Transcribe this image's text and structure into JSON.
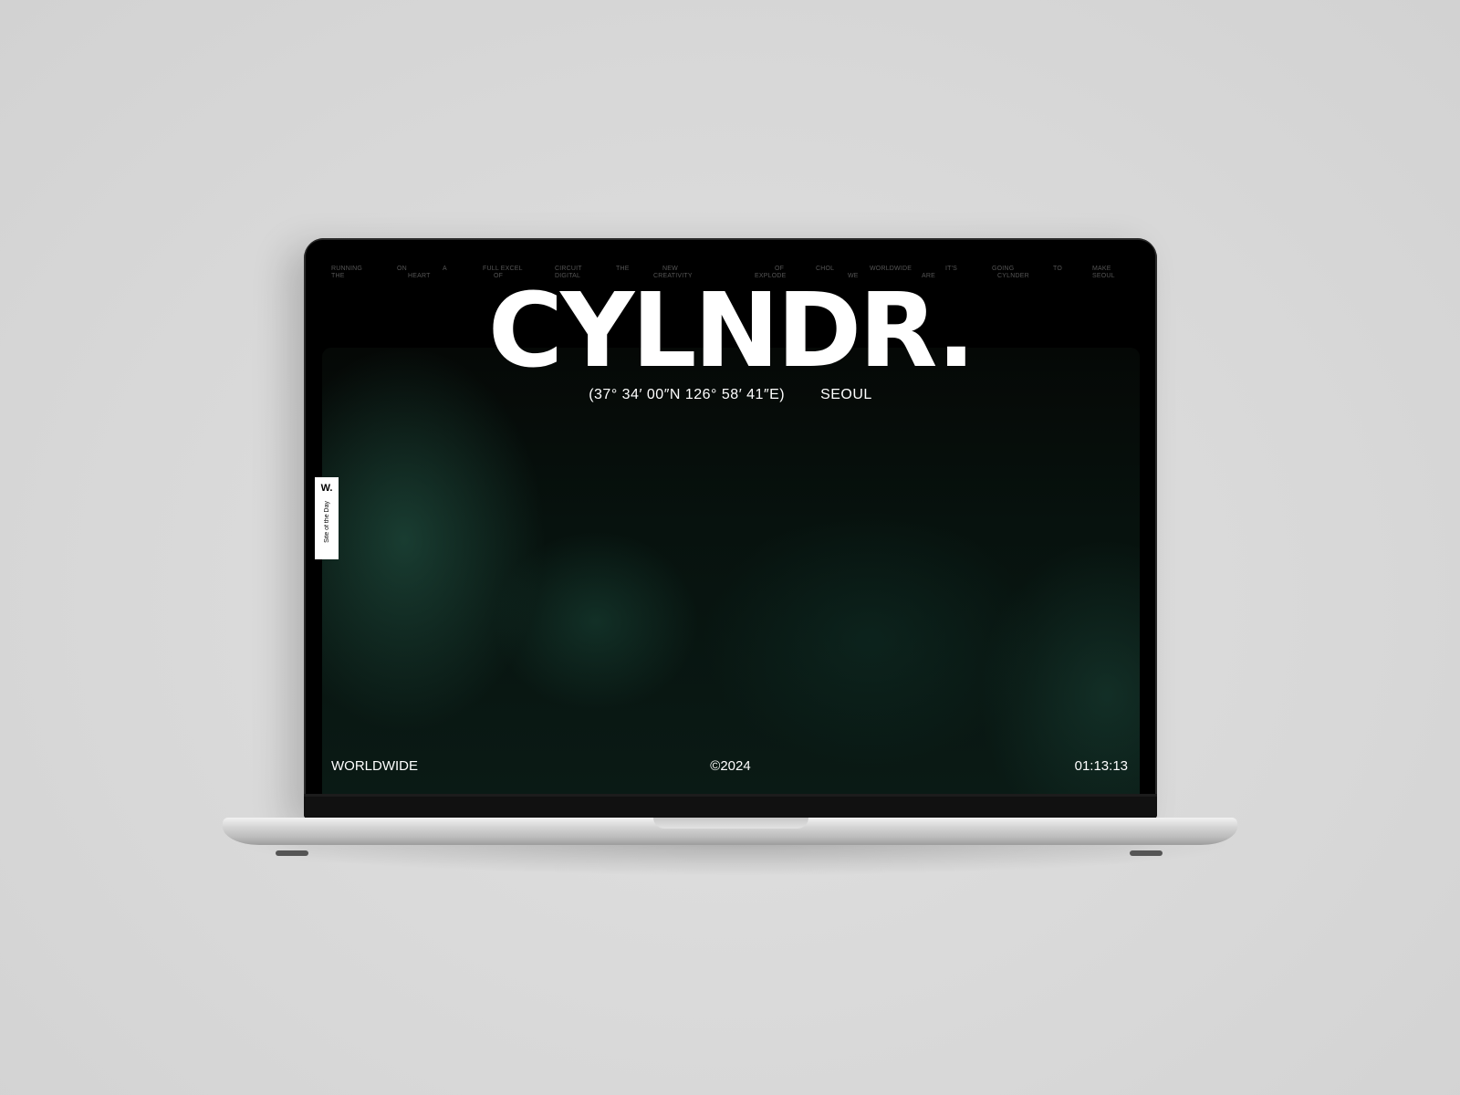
{
  "site": {
    "logo": "CYLNDR.",
    "coordinates": "(37° 34′ 00″N 126° 58′ 41″E)",
    "city": "SEOUL",
    "ticker": [
      {
        "top": "RUNNING",
        "bottom": "THE"
      },
      {
        "top": "ON",
        "bottom": "HEART"
      },
      {
        "top": "A",
        "bottom": ""
      },
      {
        "top": "FULL EXCEL",
        "bottom": "OF"
      },
      {
        "top": "CIRCUIT",
        "bottom": "DIGITAL"
      },
      {
        "top": "THE",
        "bottom": ""
      },
      {
        "top": "NEW",
        "bottom": "CREATIVITY"
      },
      {
        "top": "OF",
        "bottom": "EXPLODE"
      },
      {
        "top": "CHOL",
        "bottom": "WE"
      },
      {
        "top": "WORLDWIDE",
        "bottom": "ARE"
      },
      {
        "top": "IT'S",
        "bottom": ""
      },
      {
        "top": "GOING",
        "bottom": "CYLNDER"
      },
      {
        "top": "TO",
        "bottom": ""
      },
      {
        "top": "MAKE",
        "bottom": "SEOUL"
      }
    ],
    "badge": {
      "mark": "W.",
      "label": "Site of the Day"
    },
    "footer": {
      "left": "WORLDWIDE",
      "center": "©2024",
      "right": "01:13:13"
    }
  },
  "colors": {
    "background": "#dcdcdc",
    "screen": "#000000",
    "accent": "#1f4a3e",
    "text": "#ffffff"
  }
}
